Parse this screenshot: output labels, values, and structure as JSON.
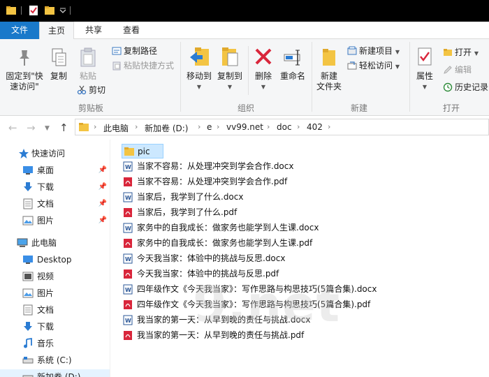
{
  "ribbon_tabs": {
    "file": "文件",
    "home": "主页",
    "share": "共享",
    "view": "查看"
  },
  "ribbon": {
    "clipboard": {
      "pin_line1": "固定到\"快",
      "pin_line2": "速访问\"",
      "copy": "复制",
      "paste": "粘贴",
      "copy_path": "复制路径",
      "paste_shortcut": "粘贴快捷方式",
      "cut": "剪切",
      "group_label": "剪贴板"
    },
    "organize": {
      "move_to": "移动到",
      "copy_to": "复制到",
      "delete": "删除",
      "rename": "重命名",
      "group_label": "组织"
    },
    "new": {
      "new_folder_line1": "新建",
      "new_folder_line2": "文件夹",
      "new_item": "新建项目",
      "easy_access": "轻松访问",
      "group_label": "新建"
    },
    "open": {
      "properties": "属性",
      "open": "打开",
      "edit": "编辑",
      "history": "历史记录",
      "group_label": "打开"
    }
  },
  "breadcrumb": [
    "此电脑",
    "新加卷 (D:)",
    "e",
    "vv99.net",
    "doc",
    "402"
  ],
  "sidebar": {
    "quick_access": "快速访问",
    "quick_items": [
      "桌面",
      "下载",
      "文档",
      "图片"
    ],
    "this_pc": "此电脑",
    "pc_items": [
      "Desktop",
      "视频",
      "图片",
      "文档",
      "下载",
      "音乐",
      "系统 (C:)",
      "新加卷 (D:)"
    ]
  },
  "files": [
    {
      "name": "pic",
      "type": "folder"
    },
    {
      "name": "当家不容易：从处理冲突到学会合作.docx",
      "type": "docx"
    },
    {
      "name": "当家不容易：从处理冲突到学会合作.pdf",
      "type": "pdf"
    },
    {
      "name": "当家后，我学到了什么.docx",
      "type": "docx"
    },
    {
      "name": "当家后，我学到了什么.pdf",
      "type": "pdf"
    },
    {
      "name": "家务中的自我成长：做家务也能学到人生课.docx",
      "type": "docx"
    },
    {
      "name": "家务中的自我成长：做家务也能学到人生课.pdf",
      "type": "pdf"
    },
    {
      "name": "今天我当家：体验中的挑战与反思.docx",
      "type": "docx"
    },
    {
      "name": "今天我当家：体验中的挑战与反思.pdf",
      "type": "pdf"
    },
    {
      "name": "四年级作文《今天我当家》：写作思路与构思技巧(5篇合集).docx",
      "type": "docx"
    },
    {
      "name": "四年级作文《今天我当家》：写作思路与构思技巧(5篇合集).pdf",
      "type": "pdf"
    },
    {
      "name": "我当家的第一天：从早到晚的责任与挑战.docx",
      "type": "docx"
    },
    {
      "name": "我当家的第一天：从早到晚的责任与挑战.pdf",
      "type": "pdf"
    }
  ],
  "watermark": "9.net",
  "colors": {
    "accent": "#1979ca",
    "selection": "#cce8ff",
    "folder": "#f3c443",
    "pdf": "#d9263b",
    "word": "#2b5797"
  }
}
